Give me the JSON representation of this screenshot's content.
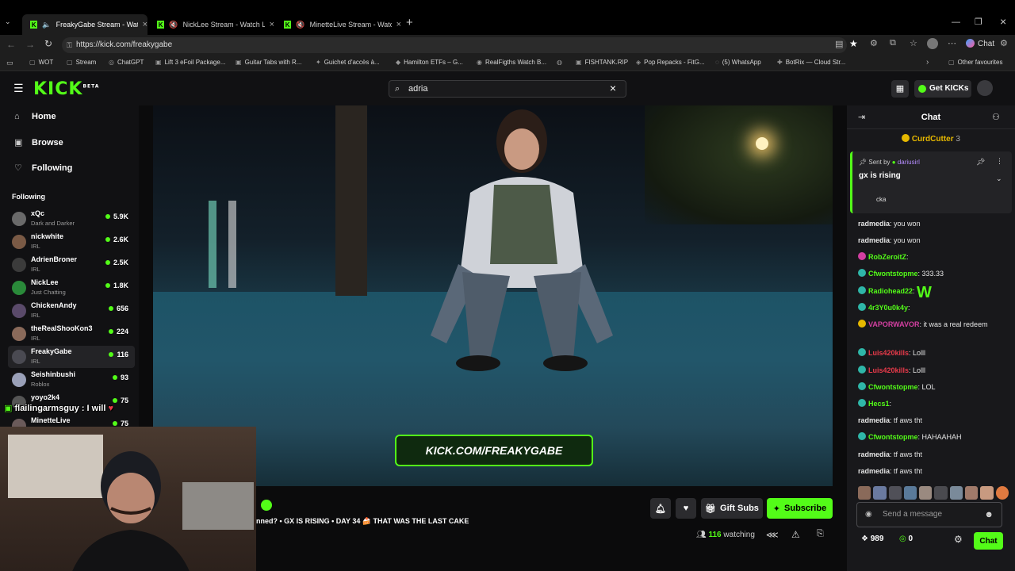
{
  "browser": {
    "tabs": [
      {
        "title": "FreakyGabe Stream - Watch L",
        "active": true
      },
      {
        "title": "NickLee Stream - Watch Live",
        "active": false
      },
      {
        "title": "MinetteLive Stream - Watch L",
        "active": false
      }
    ],
    "url": "https://kick.com/freakygabe",
    "chat_button_label": "Chat",
    "bookmarks": [
      "WOT",
      "Stream",
      "ChatGPT",
      "Lift 3 eFoil Package...",
      "Guitar Tabs with R...",
      "Guichet d'accès à...",
      "Hamilton ETFs – G...",
      "RealFigths Watch B...",
      "FISHTANK.RIP",
      "Pop Repacks - FitG...",
      "(5) WhatsApp",
      "BotRix — Cloud Str...",
      "Other favourites"
    ]
  },
  "kick": {
    "search_value": "adria",
    "get_kicks_label": "Get KICKs"
  },
  "sidebar": {
    "nav": [
      {
        "label": "Home",
        "icon": "home-icon"
      },
      {
        "label": "Browse",
        "icon": "browse-icon"
      },
      {
        "label": "Following",
        "icon": "heart-icon"
      }
    ],
    "following_header": "Following",
    "following": [
      {
        "name": "xQc",
        "category": "Dark and Darker",
        "viewers": "5.9K"
      },
      {
        "name": "nickwhite",
        "category": "IRL",
        "viewers": "2.6K"
      },
      {
        "name": "AdrienBroner",
        "category": "IRL",
        "viewers": "2.5K"
      },
      {
        "name": "NickLee",
        "category": "Just Chatting",
        "viewers": "1.8K"
      },
      {
        "name": "ChickenAndy",
        "category": "IRL",
        "viewers": "656"
      },
      {
        "name": "theRealShooKon3",
        "category": "IRL",
        "viewers": "224"
      },
      {
        "name": "FreakyGabe",
        "category": "IRL",
        "viewers": "116"
      },
      {
        "name": "Seishinbushi",
        "category": "Roblox",
        "viewers": "93"
      },
      {
        "name": "yoyo2k4",
        "category": "",
        "viewers": "75"
      },
      {
        "name": "MinetteLive",
        "category": "",
        "viewers": "75"
      }
    ]
  },
  "video": {
    "overlay_link": "KICK.COM/FREAKYGABE",
    "webcam_overlay_text": "flailingarmsguy : I will"
  },
  "stream_info": {
    "title": "nned? • GX IS RISING • DAY 34 🍰 THAT WAS THE LAST CAKE",
    "gift_subs_label": "Gift Subs",
    "subscribe_label": "Subscribe",
    "watching_count": "116",
    "watching_label": "watching"
  },
  "chat": {
    "title": "Chat",
    "top_gifter": {
      "name": "CurdCutter",
      "count": "3"
    },
    "pinned": {
      "sent_by_label": "Sent by",
      "author": "dariusirl",
      "text": "gx is rising",
      "overflow": "cka"
    },
    "messages": [
      {
        "user": "radmedia",
        "text": "you won",
        "color": "#e5e5e5",
        "badge": ""
      },
      {
        "user": "radmedia",
        "text": "you won",
        "color": "#e5e5e5",
        "badge": ""
      },
      {
        "user": "RobZeroitZ",
        "text": "",
        "color": "#53fc18",
        "badge": "#d23fa0"
      },
      {
        "user": "Cfwontstopme",
        "text": "333.33",
        "color": "#53fc18",
        "badge": "#2fb6a8"
      },
      {
        "user": "Radiohead22",
        "text": "W",
        "color": "#53fc18",
        "badge": "#2fb6a8"
      },
      {
        "user": "4r3Y0u0k4y",
        "text": "",
        "color": "#53fc18",
        "badge": "#2fb6a8"
      },
      {
        "user": "VAPORWAVOR",
        "text": "it was a real redeem",
        "color": "#d23fa0",
        "badge": "#e6b800"
      },
      {
        "user": "Luis420kills",
        "text": "Lolll",
        "color": "#e83a4a",
        "badge": "#2fb6a8"
      },
      {
        "user": "Luis420kills",
        "text": "Lolll",
        "color": "#e83a4a",
        "badge": "#2fb6a8"
      },
      {
        "user": "Cfwontstopme",
        "text": "LOL",
        "color": "#53fc18",
        "badge": "#2fb6a8"
      },
      {
        "user": "Hecs1",
        "text": "",
        "color": "#53fc18",
        "badge": "#2fb6a8"
      },
      {
        "user": "radmedia",
        "text": "tf aws tht",
        "color": "#e5e5e5",
        "badge": ""
      },
      {
        "user": "Cfwontstopme",
        "text": "HAHAAHAH",
        "color": "#53fc18",
        "badge": "#2fb6a8"
      },
      {
        "user": "radmedia",
        "text": "tf aws tht",
        "color": "#e5e5e5",
        "badge": ""
      },
      {
        "user": "radmedia",
        "text": "tf aws tht",
        "color": "#e5e5e5",
        "badge": ""
      }
    ],
    "input_placeholder": "Send a message",
    "kicks_count": "989",
    "points_count": "0",
    "send_label": "Chat"
  }
}
